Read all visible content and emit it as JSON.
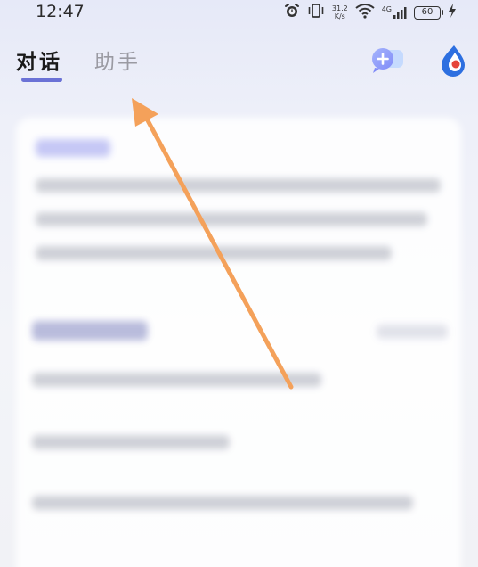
{
  "status_bar": {
    "time": "12:47",
    "net_speed_value": "31.2",
    "net_speed_unit": "K/s",
    "signal_label": "4G",
    "battery_level": "60"
  },
  "tabs": [
    {
      "label": "对话",
      "active": true
    },
    {
      "label": "助手",
      "active": false
    }
  ],
  "header_icons": [
    "new-chat-icon",
    "app-logo-icon"
  ],
  "colors": {
    "accent": "#6b72d6",
    "arrow": "#f4a15a",
    "logo_blue": "#2d6fe0",
    "logo_red": "#e5453a"
  }
}
